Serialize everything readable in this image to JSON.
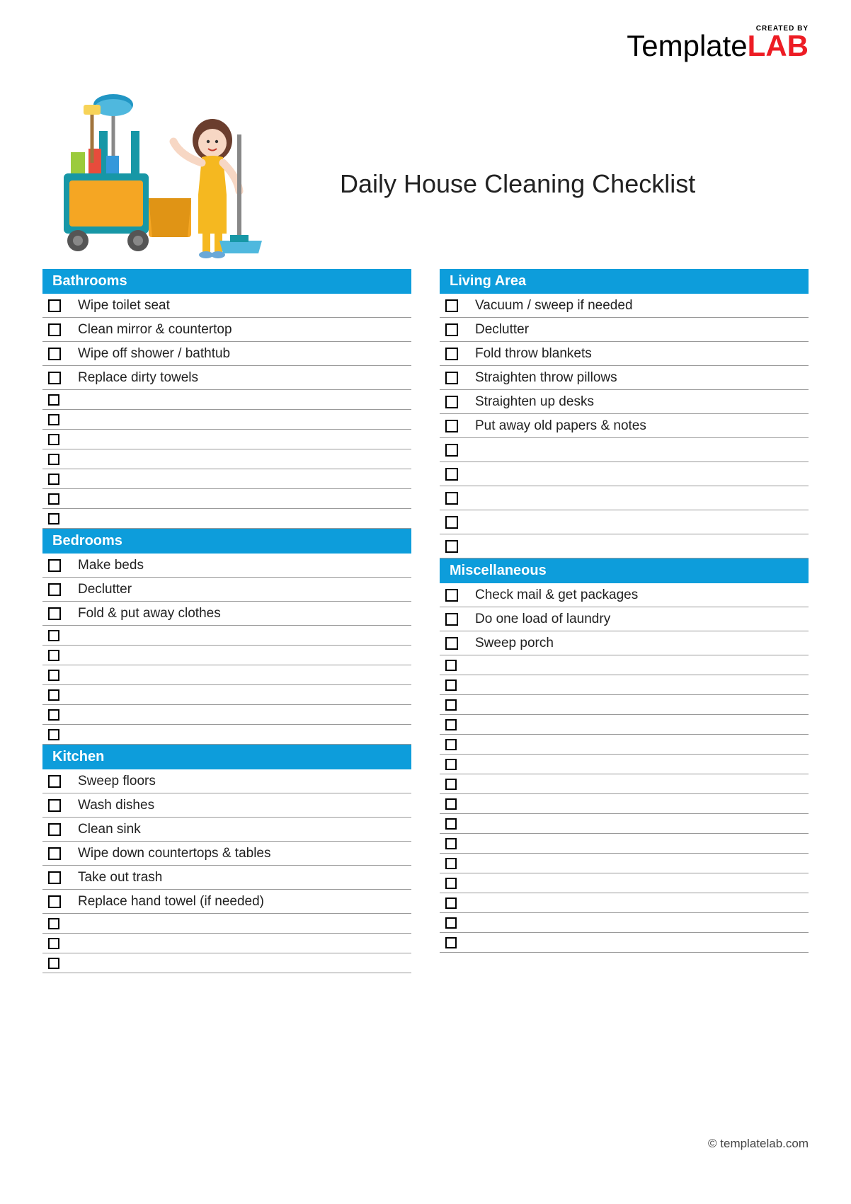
{
  "logo": {
    "created_by": "CREATED BY",
    "name_a": "Template",
    "name_b": "LAB"
  },
  "title": "Daily House Cleaning Checklist",
  "left": [
    {
      "header": "Bathrooms",
      "items": [
        "Wipe toilet seat",
        "Clean mirror & countertop",
        "Wipe off shower / bathtub",
        "Replace dirty towels"
      ],
      "blanks": 7
    },
    {
      "header": "Bedrooms",
      "items": [
        "Make beds",
        "Declutter",
        "Fold & put away clothes"
      ],
      "blanks": 6
    },
    {
      "header": "Kitchen",
      "items": [
        "Sweep floors",
        "Wash dishes",
        "Clean sink",
        "Wipe down countertops & tables",
        "Take out trash",
        "Replace hand towel (if needed)"
      ],
      "blanks": 3
    }
  ],
  "right": [
    {
      "header": "Living Area",
      "items": [
        "Vacuum / sweep if needed",
        "Declutter",
        "Fold throw blankets",
        "Straighten throw pillows",
        "Straighten up desks",
        "Put away old papers & notes"
      ],
      "blanks": 5
    },
    {
      "header": "Miscellaneous",
      "items": [
        "Check mail & get packages",
        "Do one load of laundry",
        "Sweep porch"
      ],
      "blanks": 6
    },
    {
      "header": "",
      "items": [],
      "blanks": 9
    }
  ],
  "footer": "© templatelab.com"
}
